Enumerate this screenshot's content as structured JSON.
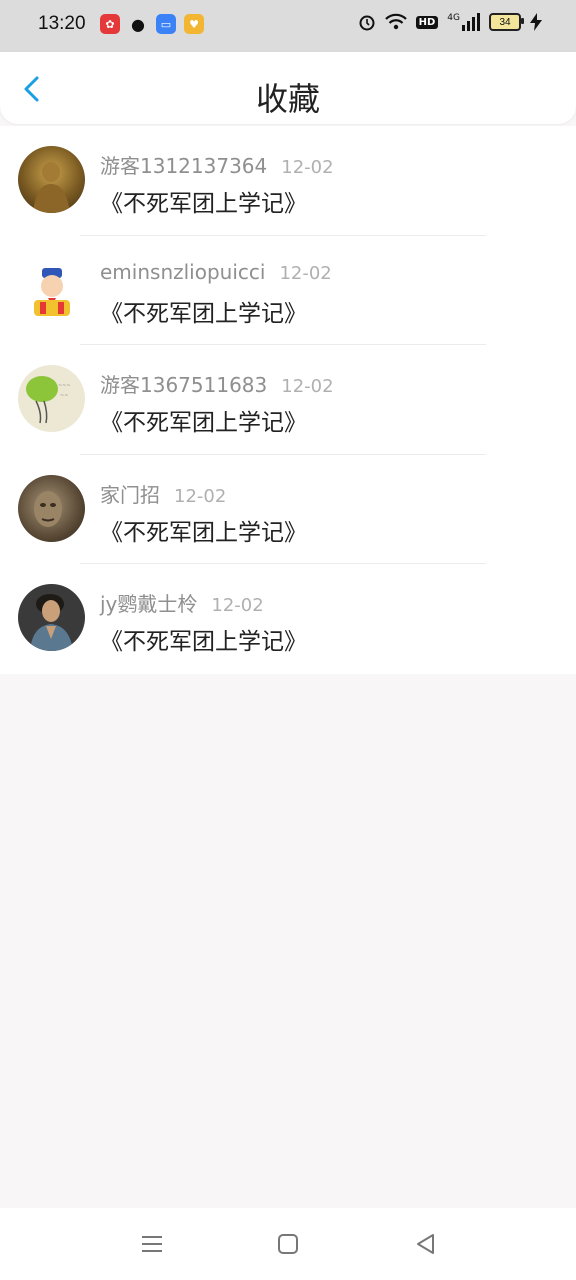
{
  "status_bar": {
    "time": "13:20",
    "battery": "34",
    "network": "4G",
    "hd": "HD",
    "app_icons": [
      "weibo-icon",
      "wechat-icon",
      "chat-bubble-icon",
      "heart-badge-icon"
    ],
    "right_icons": [
      "alarm-icon",
      "wifi-icon",
      "hd-icon",
      "signal-icon",
      "battery-icon",
      "charging-icon"
    ]
  },
  "header": {
    "title": "收藏"
  },
  "favorites": [
    {
      "user": "游客1312137364",
      "date": "12-02",
      "book": "《不死军团上学记》",
      "avatar": "buddha-statue"
    },
    {
      "user": "eminsnzliopuicci",
      "date": "12-02",
      "book": "《不死军团上学记》",
      "avatar": "cartoon-doll"
    },
    {
      "user": "游客1367511683",
      "date": "12-02",
      "book": "《不死军团上学记》",
      "avatar": "lime-sketch"
    },
    {
      "user": "家门招",
      "date": "12-02",
      "book": "《不死军团上学记》",
      "avatar": "weathered-face"
    },
    {
      "user": "jy鹦戴士柃",
      "date": "12-02",
      "book": "《不死军团上学记》",
      "avatar": "man-portrait"
    }
  ],
  "colors": {
    "accent": "#1a9ee6",
    "background": "#f8f6f7",
    "meta_text": "#8f8f8f"
  }
}
